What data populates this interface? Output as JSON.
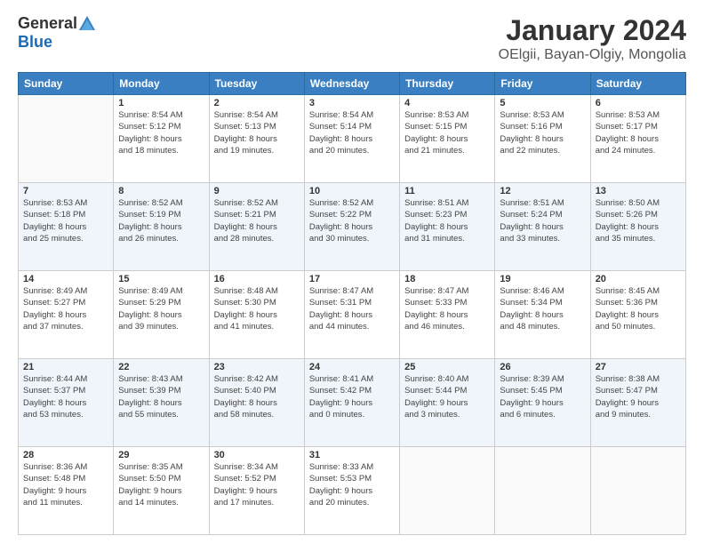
{
  "header": {
    "logo_general": "General",
    "logo_blue": "Blue",
    "title": "January 2024",
    "subtitle": "OElgii, Bayan-Olgiy, Mongolia"
  },
  "weekdays": [
    "Sunday",
    "Monday",
    "Tuesday",
    "Wednesday",
    "Thursday",
    "Friday",
    "Saturday"
  ],
  "weeks": [
    {
      "stripe": false,
      "days": [
        {
          "num": "",
          "info": ""
        },
        {
          "num": "1",
          "info": "Sunrise: 8:54 AM\nSunset: 5:12 PM\nDaylight: 8 hours\nand 18 minutes."
        },
        {
          "num": "2",
          "info": "Sunrise: 8:54 AM\nSunset: 5:13 PM\nDaylight: 8 hours\nand 19 minutes."
        },
        {
          "num": "3",
          "info": "Sunrise: 8:54 AM\nSunset: 5:14 PM\nDaylight: 8 hours\nand 20 minutes."
        },
        {
          "num": "4",
          "info": "Sunrise: 8:53 AM\nSunset: 5:15 PM\nDaylight: 8 hours\nand 21 minutes."
        },
        {
          "num": "5",
          "info": "Sunrise: 8:53 AM\nSunset: 5:16 PM\nDaylight: 8 hours\nand 22 minutes."
        },
        {
          "num": "6",
          "info": "Sunrise: 8:53 AM\nSunset: 5:17 PM\nDaylight: 8 hours\nand 24 minutes."
        }
      ]
    },
    {
      "stripe": true,
      "days": [
        {
          "num": "7",
          "info": "Sunrise: 8:53 AM\nSunset: 5:18 PM\nDaylight: 8 hours\nand 25 minutes."
        },
        {
          "num": "8",
          "info": "Sunrise: 8:52 AM\nSunset: 5:19 PM\nDaylight: 8 hours\nand 26 minutes."
        },
        {
          "num": "9",
          "info": "Sunrise: 8:52 AM\nSunset: 5:21 PM\nDaylight: 8 hours\nand 28 minutes."
        },
        {
          "num": "10",
          "info": "Sunrise: 8:52 AM\nSunset: 5:22 PM\nDaylight: 8 hours\nand 30 minutes."
        },
        {
          "num": "11",
          "info": "Sunrise: 8:51 AM\nSunset: 5:23 PM\nDaylight: 8 hours\nand 31 minutes."
        },
        {
          "num": "12",
          "info": "Sunrise: 8:51 AM\nSunset: 5:24 PM\nDaylight: 8 hours\nand 33 minutes."
        },
        {
          "num": "13",
          "info": "Sunrise: 8:50 AM\nSunset: 5:26 PM\nDaylight: 8 hours\nand 35 minutes."
        }
      ]
    },
    {
      "stripe": false,
      "days": [
        {
          "num": "14",
          "info": "Sunrise: 8:49 AM\nSunset: 5:27 PM\nDaylight: 8 hours\nand 37 minutes."
        },
        {
          "num": "15",
          "info": "Sunrise: 8:49 AM\nSunset: 5:29 PM\nDaylight: 8 hours\nand 39 minutes."
        },
        {
          "num": "16",
          "info": "Sunrise: 8:48 AM\nSunset: 5:30 PM\nDaylight: 8 hours\nand 41 minutes."
        },
        {
          "num": "17",
          "info": "Sunrise: 8:47 AM\nSunset: 5:31 PM\nDaylight: 8 hours\nand 44 minutes."
        },
        {
          "num": "18",
          "info": "Sunrise: 8:47 AM\nSunset: 5:33 PM\nDaylight: 8 hours\nand 46 minutes."
        },
        {
          "num": "19",
          "info": "Sunrise: 8:46 AM\nSunset: 5:34 PM\nDaylight: 8 hours\nand 48 minutes."
        },
        {
          "num": "20",
          "info": "Sunrise: 8:45 AM\nSunset: 5:36 PM\nDaylight: 8 hours\nand 50 minutes."
        }
      ]
    },
    {
      "stripe": true,
      "days": [
        {
          "num": "21",
          "info": "Sunrise: 8:44 AM\nSunset: 5:37 PM\nDaylight: 8 hours\nand 53 minutes."
        },
        {
          "num": "22",
          "info": "Sunrise: 8:43 AM\nSunset: 5:39 PM\nDaylight: 8 hours\nand 55 minutes."
        },
        {
          "num": "23",
          "info": "Sunrise: 8:42 AM\nSunset: 5:40 PM\nDaylight: 8 hours\nand 58 minutes."
        },
        {
          "num": "24",
          "info": "Sunrise: 8:41 AM\nSunset: 5:42 PM\nDaylight: 9 hours\nand 0 minutes."
        },
        {
          "num": "25",
          "info": "Sunrise: 8:40 AM\nSunset: 5:44 PM\nDaylight: 9 hours\nand 3 minutes."
        },
        {
          "num": "26",
          "info": "Sunrise: 8:39 AM\nSunset: 5:45 PM\nDaylight: 9 hours\nand 6 minutes."
        },
        {
          "num": "27",
          "info": "Sunrise: 8:38 AM\nSunset: 5:47 PM\nDaylight: 9 hours\nand 9 minutes."
        }
      ]
    },
    {
      "stripe": false,
      "days": [
        {
          "num": "28",
          "info": "Sunrise: 8:36 AM\nSunset: 5:48 PM\nDaylight: 9 hours\nand 11 minutes."
        },
        {
          "num": "29",
          "info": "Sunrise: 8:35 AM\nSunset: 5:50 PM\nDaylight: 9 hours\nand 14 minutes."
        },
        {
          "num": "30",
          "info": "Sunrise: 8:34 AM\nSunset: 5:52 PM\nDaylight: 9 hours\nand 17 minutes."
        },
        {
          "num": "31",
          "info": "Sunrise: 8:33 AM\nSunset: 5:53 PM\nDaylight: 9 hours\nand 20 minutes."
        },
        {
          "num": "",
          "info": ""
        },
        {
          "num": "",
          "info": ""
        },
        {
          "num": "",
          "info": ""
        }
      ]
    }
  ]
}
